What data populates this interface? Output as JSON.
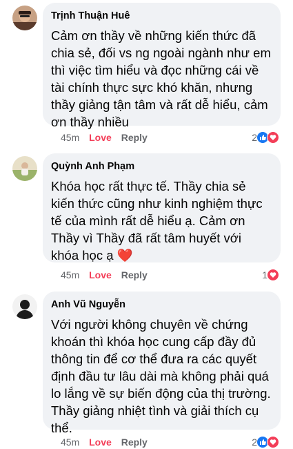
{
  "comments": [
    {
      "author": "Trịnh Thuận Huê",
      "text": "Cảm ơn thầy về những kiến thức đã chia sẻ, đối vs ng ngoài ngành như em thì việc tìm hiểu và đọc những cái về tài chính thực sực khó khăn, nhưng thầy giảng tận tâm và rất dễ hiểu, cảm ơn thầy nhiều",
      "time": "45m",
      "love_label": "Love",
      "reply_label": "Reply",
      "reaction_count": "2",
      "reaction_icons": [
        "like-icon",
        "love-icon"
      ]
    },
    {
      "author": "Quỳnh Anh Phạm",
      "text": "Khóa học rất thực tế. Thầy chia sẻ kiến thức cũng như kinh nghiệm thực tế của mình rất dễ hiểu ạ. Cảm ơn Thầy vì Thầy đã rất tâm huyết với khóa học ạ",
      "emoji": "❤️",
      "time": "45m",
      "love_label": "Love",
      "reply_label": "Reply",
      "reaction_count": "1",
      "reaction_icons": [
        "love-icon"
      ]
    },
    {
      "author": "Anh Vũ Nguyễn",
      "text": "Với người không chuyên về chứng khoán thì khóa học cung cấp đầy đủ thông tin để cơ thể đưa ra các quyết định đầu tư lâu dài mà không phải quá lo lắng về sự biến động của thị trường. Thầy giảng nhiệt tình và giải thích cụ thể.",
      "time": "45m",
      "love_label": "Love",
      "reply_label": "Reply",
      "reaction_count": "2",
      "reaction_icons": [
        "like-icon",
        "love-icon"
      ]
    }
  ],
  "colors": {
    "bubble": "#f0f2f5",
    "love": "#f33e58",
    "like": "#1877f2",
    "meta": "#65676b"
  }
}
